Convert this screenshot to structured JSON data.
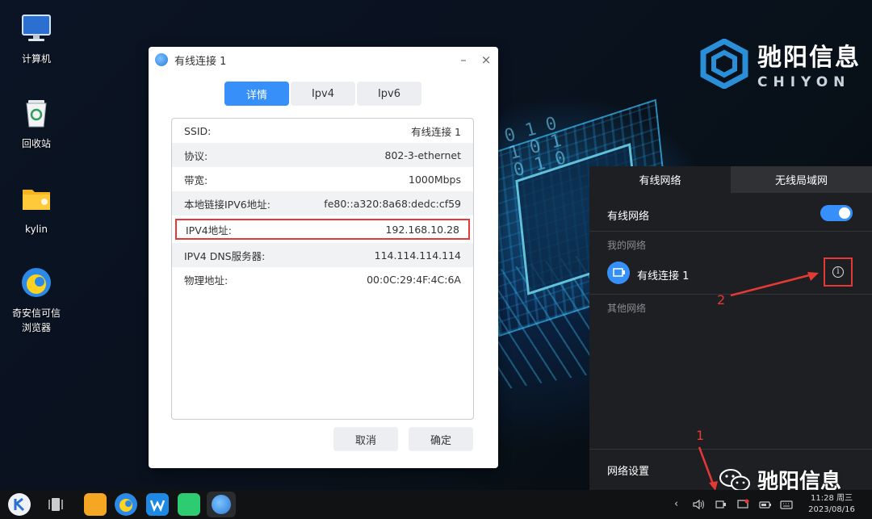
{
  "brand": {
    "cn": "驰阳信息",
    "en": "CHIYON"
  },
  "desktop": {
    "icons": [
      {
        "label": "计算机"
      },
      {
        "label": "回收站"
      },
      {
        "label": "kylin"
      },
      {
        "label": "奇安信可信",
        "label2": "浏览器"
      }
    ]
  },
  "dialog": {
    "title": "有线连接 1",
    "minimize": "–",
    "close": "×",
    "tabs": [
      {
        "label": "详情",
        "active": true
      },
      {
        "label": "Ipv4",
        "active": false
      },
      {
        "label": "Ipv6",
        "active": false
      }
    ],
    "rows": [
      {
        "key": "SSID:",
        "value": "有线连接 1"
      },
      {
        "key": "协议:",
        "value": "802-3-ethernet"
      },
      {
        "key": "带宽:",
        "value": "1000Mbps"
      },
      {
        "key": "本地链接IPV6地址:",
        "value": "fe80::a320:8a68:dedc:cf59"
      },
      {
        "key": "IPV4地址:",
        "value": "192.168.10.28"
      },
      {
        "key": "IPV4 DNS服务器:",
        "value": "114.114.114.114"
      },
      {
        "key": "物理地址:",
        "value": "00:0C:29:4F:4C:6A"
      }
    ],
    "cancel": "取消",
    "ok": "确定"
  },
  "network_panel": {
    "tab_wired": "有线网络",
    "tab_wireless": "无线局域网",
    "wired_label": "有线网络",
    "wired_enabled": true,
    "my_networks": "我的网络",
    "connection_name": "有线连接 1",
    "other_networks": "其他网络",
    "settings": "网络设置"
  },
  "annotations": {
    "one": "1",
    "two": "2"
  },
  "watermark": "驰阳信息",
  "taskbar": {
    "time": "11:28 周三",
    "date": "2023/08/16"
  },
  "colors": {
    "accent": "#3790fa",
    "annotation": "#e53935",
    "panel_bg": "#1e1f22"
  }
}
